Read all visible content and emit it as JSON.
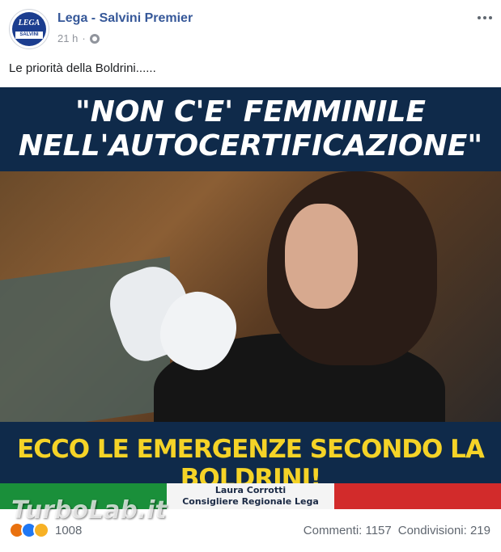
{
  "post": {
    "page_name": "Lega - Salvini Premier",
    "time": "21 h",
    "separator": "·",
    "caption": "Le priorità della Boldrini......",
    "avatar": {
      "text": "LEGA",
      "subtext": "SALVINI"
    }
  },
  "image": {
    "quote_line1": "\"NON C'E' FEMMINILE",
    "quote_line2": "NELL'AUTOCERTIFICAZIONE\"",
    "headline": "ECCO LE EMERGENZE SECONDO LA BOLDRINI!",
    "signer_name": "Laura Corrotti",
    "signer_role": "Consigliere Regionale Lega",
    "flag_colors": [
      "#1a8f3a",
      "#f4f4f4",
      "#d22b2b"
    ]
  },
  "watermark": "TurboLab.it",
  "footer": {
    "reaction_count": "1008",
    "comments": "Commenti: 1157",
    "shares": "Condivisioni: 219",
    "reaction_icons": [
      "angry-icon",
      "like-icon",
      "sad-icon"
    ]
  },
  "colors": {
    "link": "#365899",
    "banner": "#0f2a4a",
    "headline": "#f5d327"
  }
}
